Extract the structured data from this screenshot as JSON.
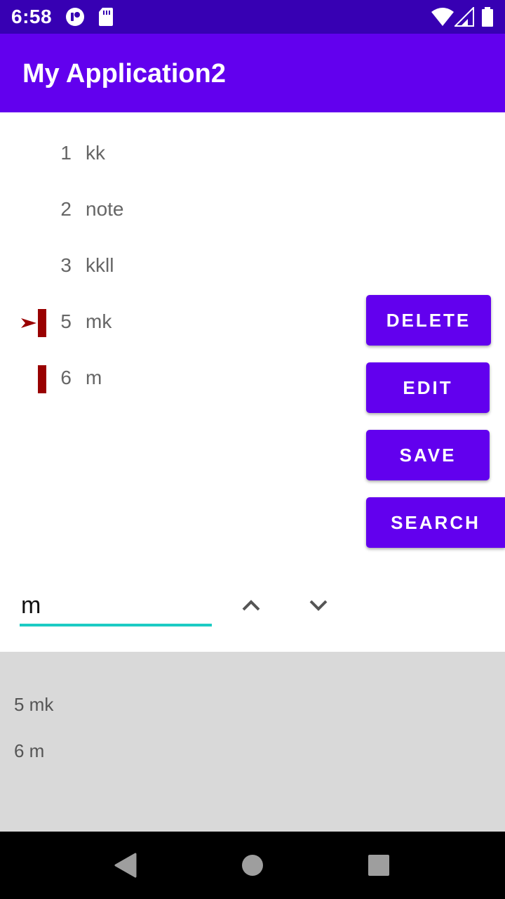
{
  "status_bar": {
    "time": "6:58",
    "icons": [
      "app-notification-icon",
      "sd-card-icon",
      "wifi-icon",
      "cell-signal-icon",
      "battery-icon"
    ],
    "background": "#3700B3"
  },
  "app_bar": {
    "title": "My Application2",
    "background": "#6200EE"
  },
  "list": {
    "items": [
      {
        "number": "1",
        "text": "kk",
        "marked": false,
        "current": false
      },
      {
        "number": "2",
        "text": "note",
        "marked": false,
        "current": false
      },
      {
        "number": "3",
        "text": "kkll",
        "marked": false,
        "current": false
      },
      {
        "number": "5",
        "text": "mk",
        "marked": true,
        "current": true
      },
      {
        "number": "6",
        "text": "m",
        "marked": true,
        "current": false
      }
    ],
    "marker_color": "#990000"
  },
  "buttons": {
    "delete": "DELETE",
    "edit": "EDIT",
    "save": "SAVE",
    "search": "SEARCH",
    "color": "#6200EE"
  },
  "search": {
    "value": "m",
    "underline_color": "#1CCBC4",
    "prev_icon": "chevron-up-icon",
    "next_icon": "chevron-down-icon"
  },
  "results": {
    "items": [
      "5 mk",
      "6 m"
    ],
    "background": "#D9D9D9"
  },
  "nav_bar": {
    "icons": [
      "back-icon",
      "home-icon",
      "recents-icon"
    ]
  }
}
